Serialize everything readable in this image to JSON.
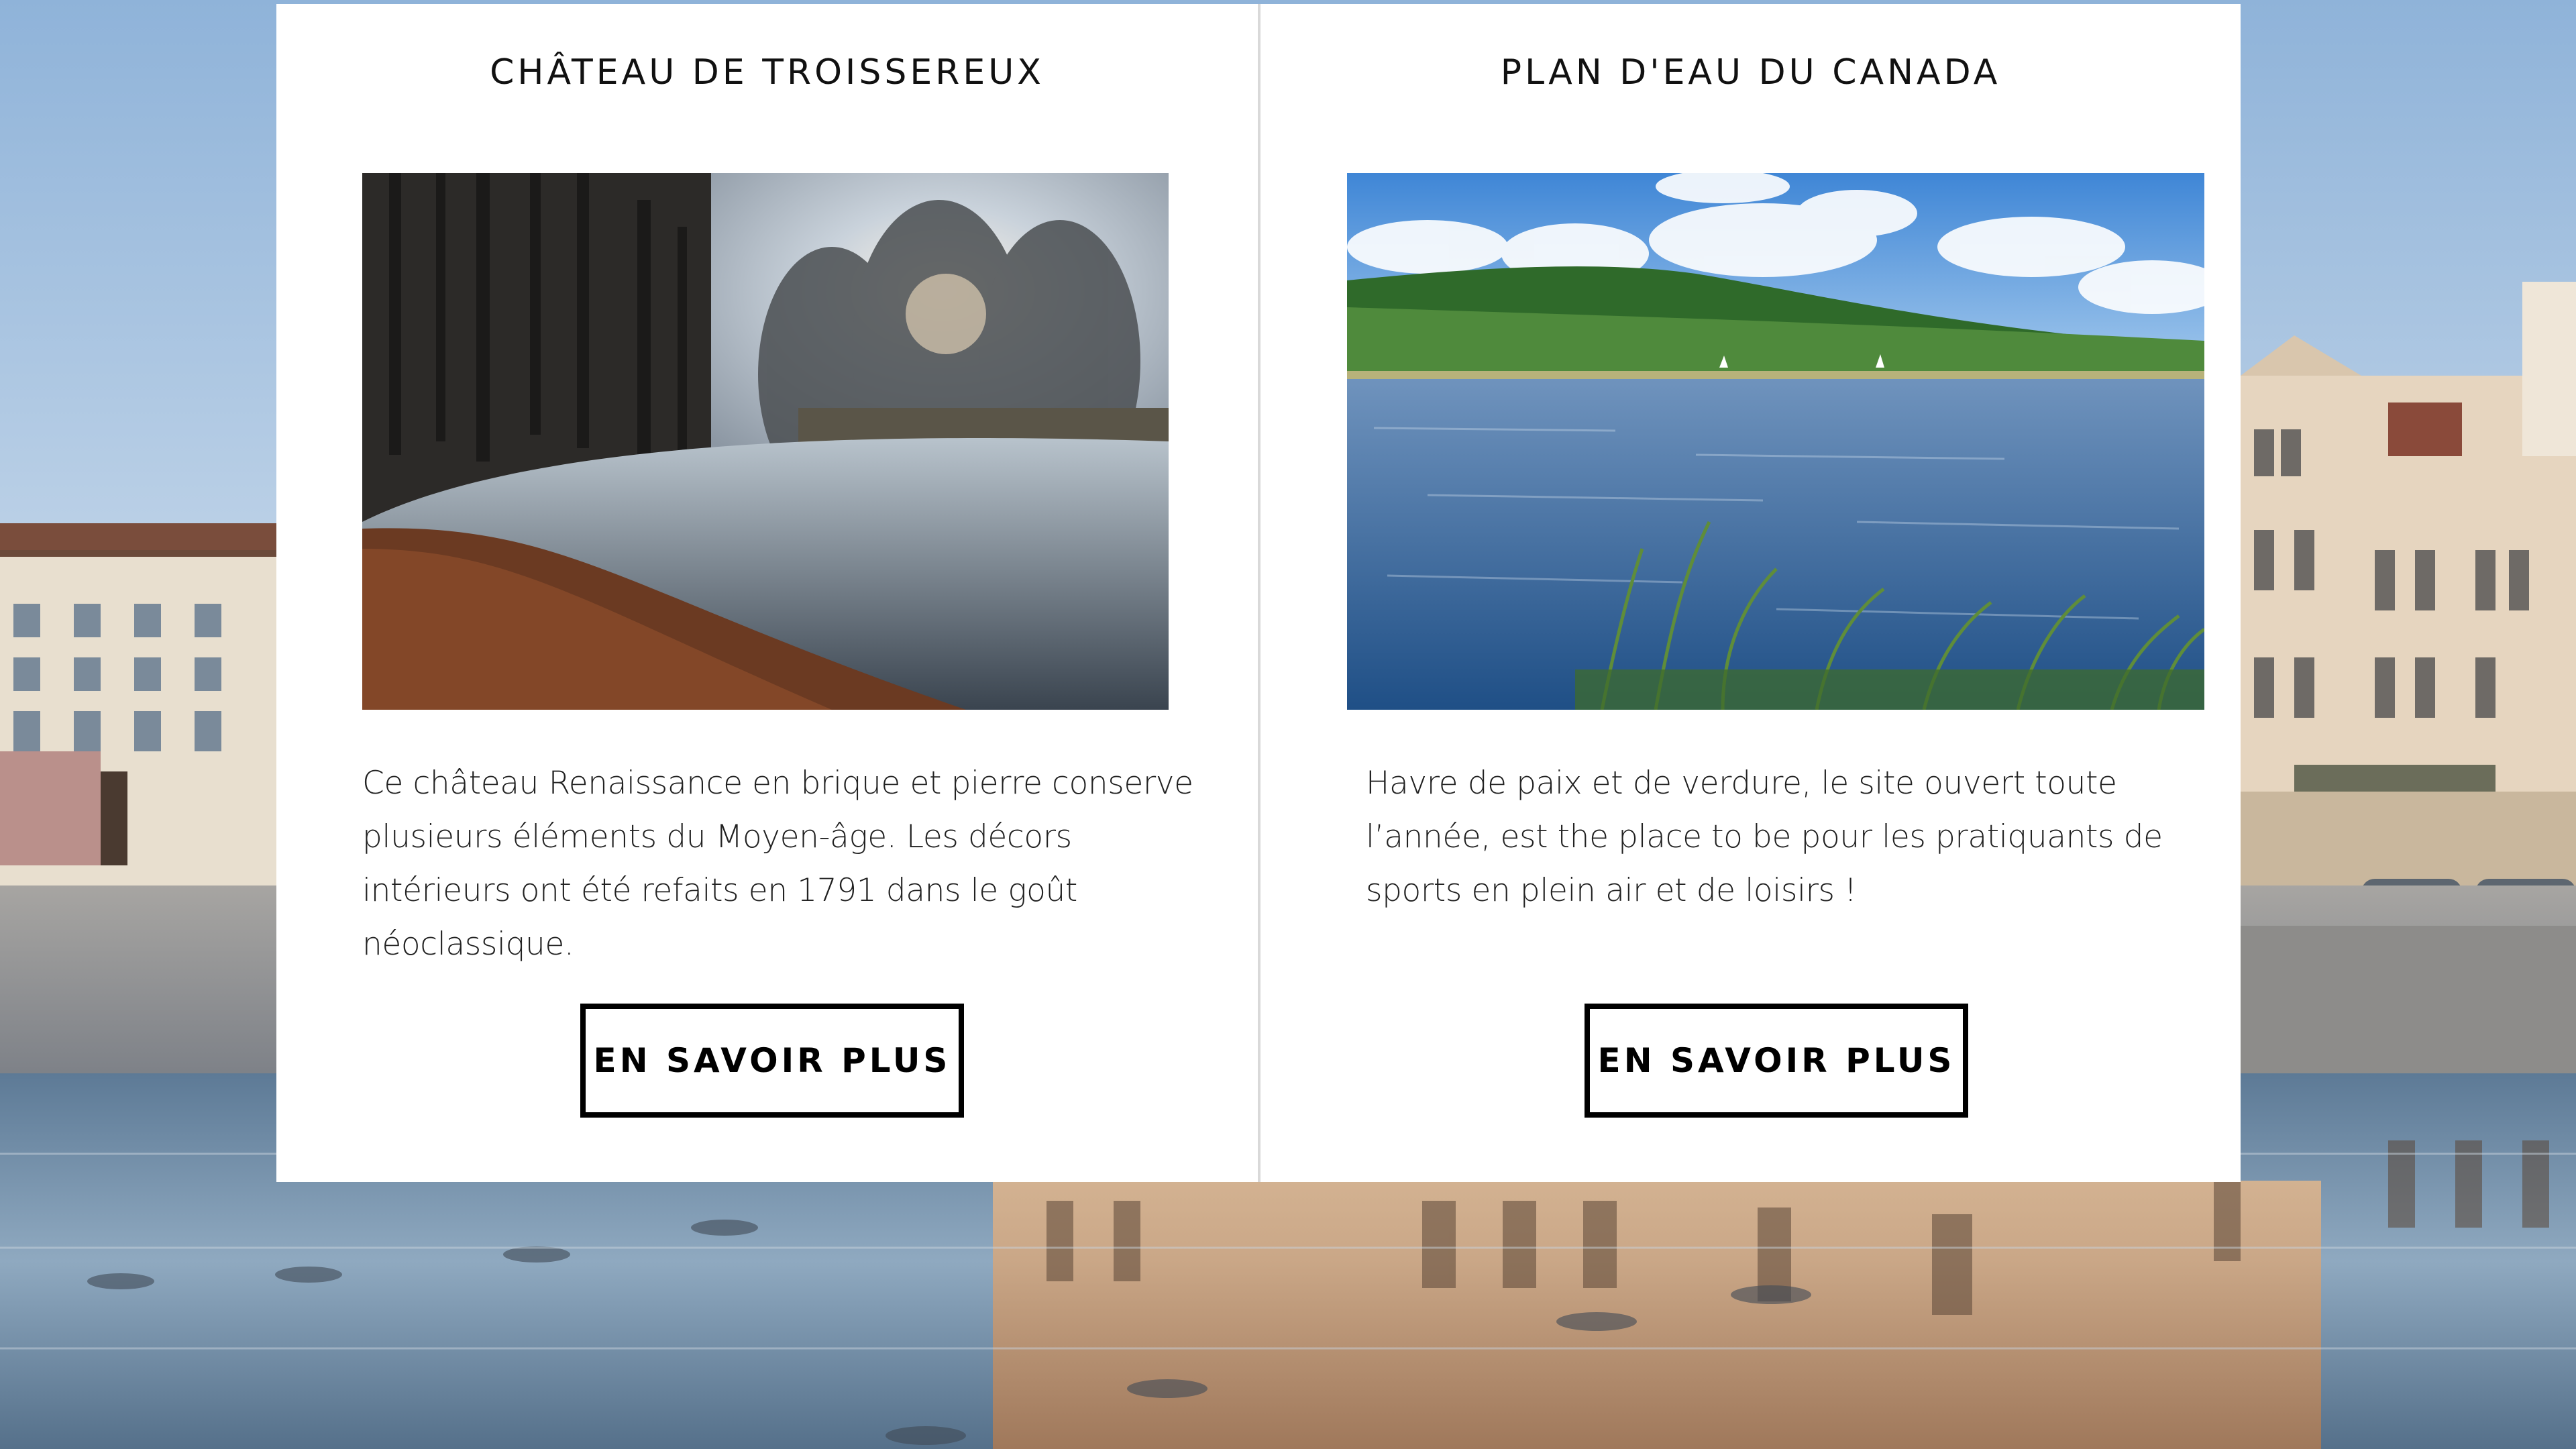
{
  "cards": [
    {
      "title": "CHÂTEAU DE TROISSEREUX",
      "image": "park-river-autumn-photo",
      "description": "Ce château Renaissance en brique et pierre conserve plusieurs éléments du Moyen-âge. Les décors intérieurs ont été refaits en 1791 dans le goût néoclassique.",
      "button_label": "EN SAVOIR PLUS"
    },
    {
      "title": "PLAN D'EAU DU CANADA",
      "image": "lake-green-hills-photo",
      "description": "Havre de paix et de verdure, le site ouvert toute l’année, est the place to be pour les pratiquants de sports en plein air et de loisirs !",
      "button_label": "EN SAVOIR PLUS"
    }
  ],
  "background": {
    "image": "town-square-fountain-reflection-photo"
  },
  "colors": {
    "card_background": "#ffffff",
    "text": "#222222",
    "button_border": "#000000",
    "divider": "#d9d9d9"
  }
}
